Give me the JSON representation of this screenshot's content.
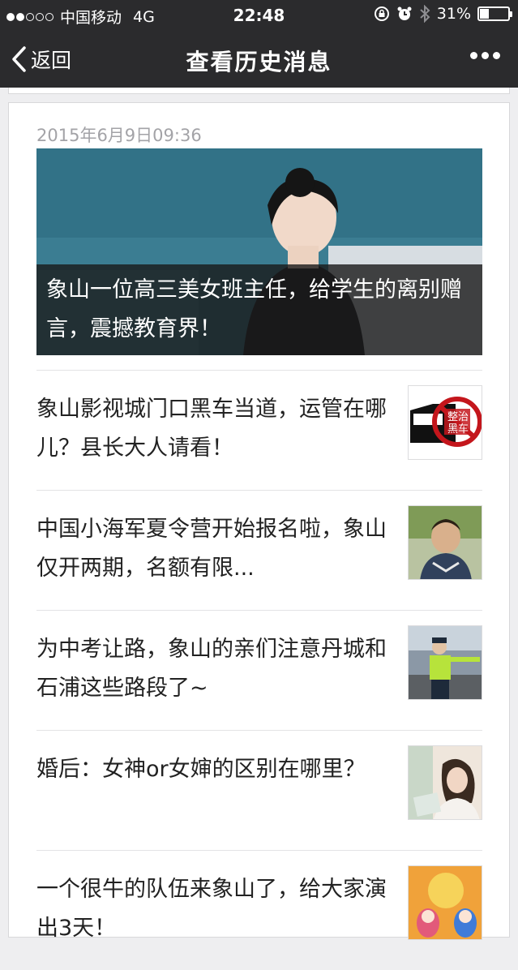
{
  "status_bar": {
    "carrier": "中国移动",
    "network": "4G",
    "time": "22:48",
    "battery": "31%",
    "battery_level": 0.31,
    "icons": [
      "lock-rotation-icon",
      "alarm-icon",
      "bluetooth-icon",
      "battery-icon"
    ]
  },
  "nav": {
    "back_label": "返回",
    "title": "查看历史消息",
    "more_icon": "more-icon"
  },
  "message": {
    "timestamp": "2015年6月9日09:36",
    "featured": {
      "title": "象山一位高三美女班主任，给学生的离别赠言，震撼教育界！"
    },
    "articles": [
      {
        "title": "象山影视城门口黑车当道，运管在哪儿？县长大人请看！",
        "thumb_text": "整治黑车"
      },
      {
        "title": "中国小海军夏令营开始报名啦，象山仅开两期，名额有限..."
      },
      {
        "title": "为中考让路，象山的亲们注意丹城和石浦这些路段了~"
      },
      {
        "title": "婚后：女神or女婶的区别在哪里？"
      },
      {
        "title": "一个很牛的队伍来象山了，给大家演出3天！"
      }
    ]
  },
  "colors": {
    "bar_bg": "#2b2b2d",
    "page_bg": "#eeeef0",
    "text": "#222222",
    "timestamp": "#a3a3a7"
  }
}
